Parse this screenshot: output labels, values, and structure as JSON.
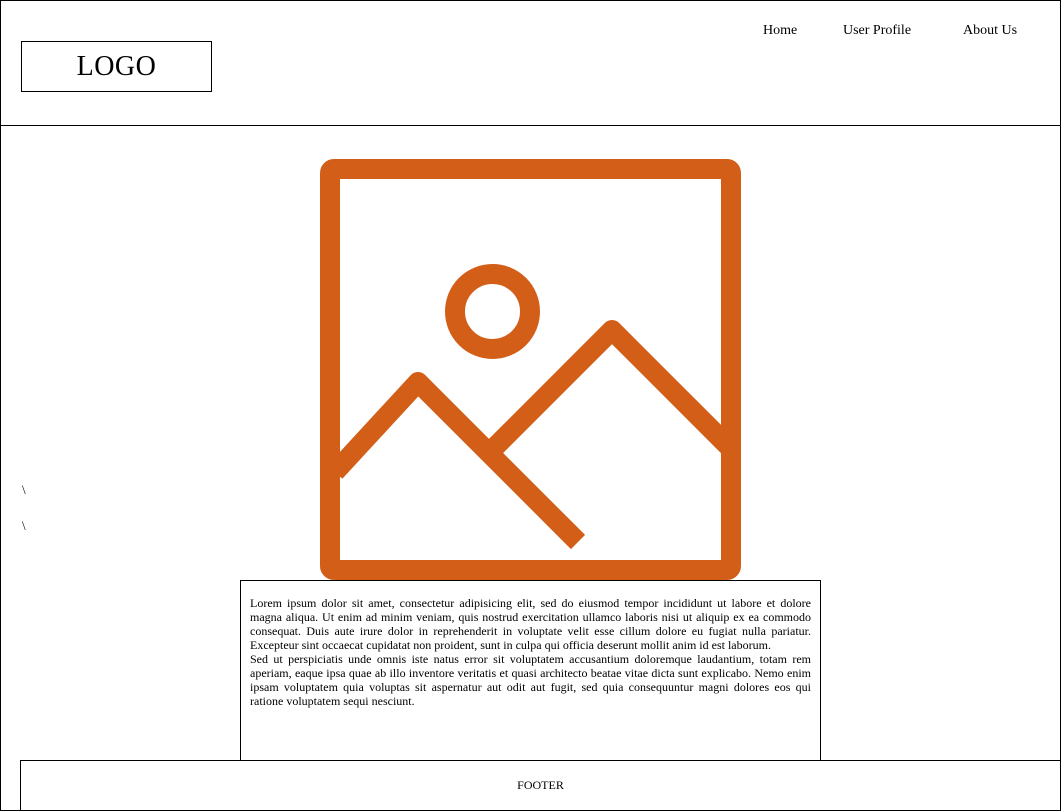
{
  "header": {
    "logo_text": "LOGO",
    "nav": {
      "home": "Home",
      "user_profile": "User Profile",
      "about_us": "About Us"
    }
  },
  "main": {
    "image_placeholder_icon": "image-icon",
    "markers": [
      "\\",
      "\\"
    ],
    "paragraphs": [
      "Lorem ipsum dolor sit amet, consectetur adipisicing elit, sed do eiusmod tempor incididunt ut labore et dolore magna aliqua. Ut enim ad minim veniam, quis nostrud exercitation ullamco laboris nisi ut aliquip ex ea commodo consequat. Duis aute irure dolor in reprehenderit in voluptate velit esse cillum dolore eu fugiat nulla pariatur. Excepteur sint occaecat cupidatat non proident, sunt in culpa qui officia deserunt mollit anim id est laborum.",
      "Sed ut perspiciatis unde omnis iste natus error sit voluptatem accusantium doloremque laudantium, totam rem aperiam, eaque ipsa quae ab illo inventore veritatis et quasi architecto beatae vitae dicta sunt explicabo. Nemo enim ipsam voluptatem quia voluptas sit aspernatur aut odit aut fugit, sed quia consequuntur magni dolores eos qui ratione voluptatem sequi nesciunt."
    ]
  },
  "footer": {
    "label": "FOOTER"
  },
  "colors": {
    "accent": "#D35E18",
    "stroke": "#000000",
    "background": "#FFFFFF"
  }
}
